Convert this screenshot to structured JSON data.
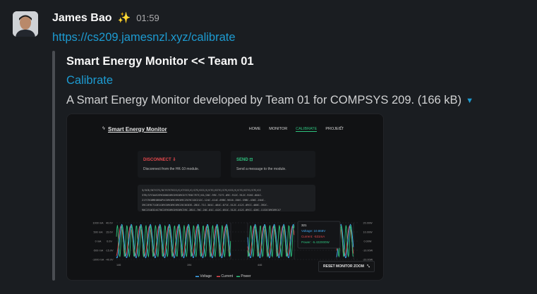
{
  "message": {
    "author": "James Bao",
    "status_emoji": "✨",
    "time": "01:59",
    "link": "https://cs209.jamesnzl.xyz/calibrate"
  },
  "unfurl": {
    "site_title": "Smart Energy Monitor << Team 01",
    "page_title": "Calibrate",
    "description": "A Smart Energy Monitor developed by Team 01 for COMPSYS 209. (166 kB)"
  },
  "preview": {
    "brand": "Smart Energy Monitor",
    "nav": [
      "HOME",
      "MONITOR",
      "CALIBRATE",
      "PROJECT"
    ],
    "active_nav": "CALIBRATE",
    "disconnect": {
      "title": "DISCONNECT",
      "subtitle": "Disconnect from the HK-10 module."
    },
    "send": {
      "title": "SEND",
      "subtitle": "Send a message to the module."
    },
    "console_lines": [
      "3/3CE/3C7C7C/3C7C7C7CCC/C/C7CCC/C/C7C/CCC/C/C7C/CC7C/C7C/CCC/C/C7C/CC7C/C7C/CC",
      "37B/37C5AE2E9C000C09C09C09C07C7E0C7E7C/01/20C-99C-727C-09C-912C-912C-926C-604C-",
      "217C9C0ME0B5OP4C09C09C09C09C25C9C1DC212C-124C-414C-69BC-9616-150C-S9BC-436C-204C-",
      "39C2E9C71OE1C09C09C09C09C25C0C63S-2B1C-71C-301C-464C-071C-512C-412C-09CC-460C-392C-",
      "90C2316324C70C2E9C09C09C09C39C-2B1C-70C-20C-01C-412C-051C-312C-412C-09CC-426C-1132C09C09C47"
    ],
    "chart_legend": [
      "Voltage",
      "Current",
      "Power"
    ],
    "tooltip": {
      "title": "321",
      "voltage": "Voltage: 10.868V",
      "current": "Current: -531mA",
      "power": "Power: -5.432000W"
    },
    "left_axis_current": [
      "1000 mA",
      "500 mA",
      "0 mA",
      "-500 mA",
      "-1000 mA"
    ],
    "left_axis_voltage": [
      "40.0V",
      "15.0V",
      "0.0V",
      "-15.0V",
      "-40.0V"
    ],
    "right_axis": [
      "20.00W",
      "10.00W",
      "0.00W",
      "-10.00W",
      "-20.00W"
    ],
    "x_ticks": [
      "146",
      "194",
      "446",
      "2??"
    ],
    "reset_button": "RESET MONITOR ZOOM"
  },
  "colors": {
    "voltage": "#3fa9f5",
    "current": "#e5484d",
    "power": "#2ec27e",
    "link": "#1d9bd1"
  }
}
